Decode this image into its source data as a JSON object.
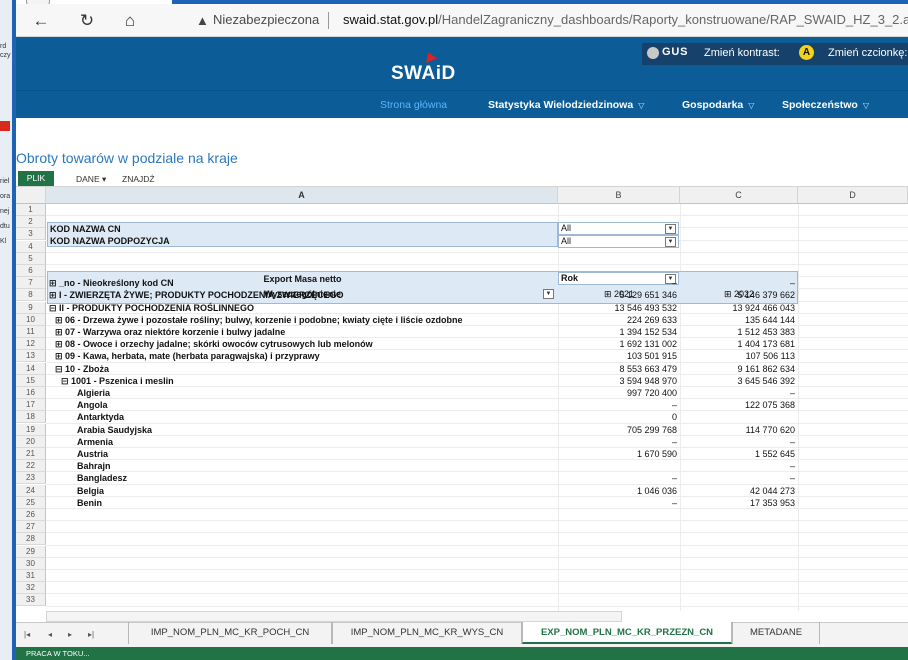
{
  "desktop": {
    "fragments": [
      "rd",
      "czy",
      "riel",
      "ora",
      "nej",
      "dtu",
      "Kl"
    ]
  },
  "browser": {
    "security_label": "Niezabezpieczona",
    "url_host": "swaid.stat.gov.pl",
    "url_path": "/HandelZagraniczny_dashboards/Raporty_konstruowane/RAP_SWAID_HZ_3_2.as"
  },
  "site": {
    "logo": "SWAiD",
    "gus": "GUS",
    "contrast_label": "Zmień kontrast:",
    "contrast_icon": "A",
    "font_label": "Zmień czcionkę:",
    "nav": [
      {
        "label": "Strona główna"
      },
      {
        "label": "Statystyka Wielodziedzinowa",
        "arrow": "▽"
      },
      {
        "label": "Gospodarka",
        "arrow": "▽"
      },
      {
        "label": "Społeczeństwo",
        "arrow": "▽"
      }
    ]
  },
  "report": {
    "title": "Obroty towarów w podziale na kraje",
    "ribbon": {
      "plik": "PLIK",
      "dane": "DANE ▾",
      "znajdz": "ZNAJDŹ"
    }
  },
  "grid": {
    "columns": [
      "A",
      "B",
      "C",
      "D"
    ],
    "filters": [
      {
        "label": "KOD NAZWA CN",
        "value": "All"
      },
      {
        "label": "KOD NAZWA PODPOZYCJA",
        "value": "All"
      }
    ],
    "pivot_header": {
      "measure": "Export Masa netto",
      "rows_label": "Wyszczególnienie",
      "col_label": "Rok",
      "year1": "⊞ 2021",
      "year2": "⊞ 2022"
    },
    "rows": [
      {
        "label": "⊞ _no - Nieokreślony kod CN",
        "indent": 0,
        "v2021": "–",
        "v2022": "–"
      },
      {
        "label": "⊞ I - ZWIERZĘTA ŻYWE; PRODUKTY POCHODZENIA ZWIERZĘCEGO",
        "indent": 0,
        "v2021": "5 129 651 346",
        "v2022": "5 146 379 662"
      },
      {
        "label": "⊟ II - PRODUKTY POCHODZENIA ROŚLINNEGO",
        "indent": 0,
        "v2021": "13 546 493 532",
        "v2022": "13 924 466 043"
      },
      {
        "label": "⊞ 06 - Drzewa żywe i pozostałe rośliny; bulwy, korzenie i podobne; kwiaty cięte i liście ozdobne",
        "indent": 1,
        "v2021": "224 269 633",
        "v2022": "135 644 144"
      },
      {
        "label": "⊞ 07 - Warzywa oraz niektóre korzenie i bulwy jadalne",
        "indent": 1,
        "v2021": "1 394 152 534",
        "v2022": "1 512 453 383"
      },
      {
        "label": "⊞ 08 - Owoce i orzechy jadalne; skórki owoców cytrusowych lub melonów",
        "indent": 1,
        "v2021": "1 692 131 002",
        "v2022": "1 404 173 681"
      },
      {
        "label": "⊞ 09 - Kawa, herbata, mate (herbata paragwajska) i przyprawy",
        "indent": 1,
        "v2021": "103 501 915",
        "v2022": "107 506 113"
      },
      {
        "label": "⊟ 10 - Zboża",
        "indent": 1,
        "v2021": "8 553 663 479",
        "v2022": "9 161 862 634"
      },
      {
        "label": "⊟ 1001 - Pszenica i meslin",
        "indent": 2,
        "v2021": "3 594 948 970",
        "v2022": "3 645 546 392"
      },
      {
        "label": "Algieria",
        "indent": 3,
        "v2021": "997 720 400",
        "v2022": "–"
      },
      {
        "label": "Angola",
        "indent": 3,
        "v2021": "–",
        "v2022": "122 075 368"
      },
      {
        "label": "Antarktyda",
        "indent": 3,
        "v2021": "0",
        "v2022": ""
      },
      {
        "label": "Arabia Saudyjska",
        "indent": 3,
        "v2021": "705 299 768",
        "v2022": "114 770 620"
      },
      {
        "label": "Armenia",
        "indent": 3,
        "v2021": "–",
        "v2022": "–"
      },
      {
        "label": "Austria",
        "indent": 3,
        "v2021": "1 670 590",
        "v2022": "1 552 645"
      },
      {
        "label": "Bahrajn",
        "indent": 3,
        "v2021": "",
        "v2022": "–"
      },
      {
        "label": "Bangladesz",
        "indent": 3,
        "v2021": "–",
        "v2022": "–"
      },
      {
        "label": "Belgia",
        "indent": 3,
        "v2021": "1 046 036",
        "v2022": "42 044 273"
      },
      {
        "label": "Benin",
        "indent": 3,
        "v2021": "–",
        "v2022": "17 353 953"
      }
    ]
  },
  "sheets": {
    "tabs": [
      "IMP_NOM_PLN_MC_KR_POCH_CN",
      "IMP_NOM_PLN_MC_KR_WYS_CN",
      "EXP_NOM_PLN_MC_KR_PRZEZN_CN",
      "METADANE"
    ],
    "active_index": 2
  },
  "status": "PRACA W TOKU..."
}
